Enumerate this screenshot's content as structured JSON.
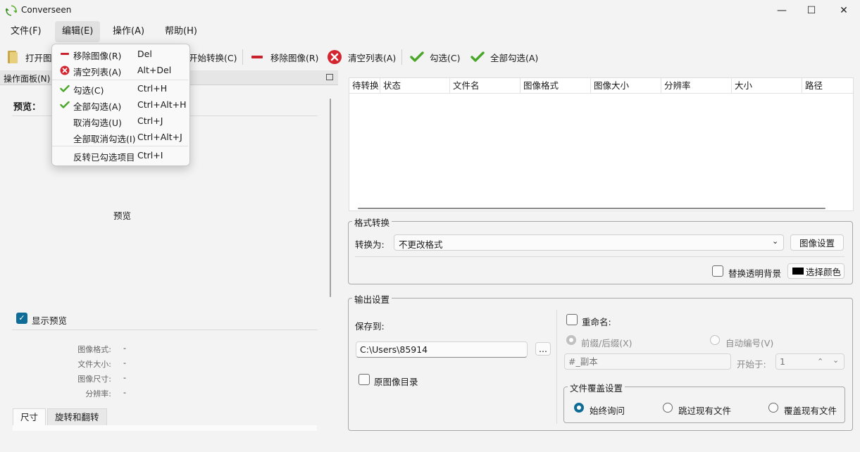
{
  "window": {
    "title": "Converseen",
    "minimize": "—",
    "maximize": "☐",
    "close": "✕"
  },
  "menubar": [
    "文件(F)",
    "编辑(E)",
    "操作(A)",
    "帮助(H)"
  ],
  "toolbar": {
    "open": "打开图",
    "convert": "开始转换(C)",
    "remove": "移除图像(R)",
    "clear": "清空列表(A)",
    "check": "勾选(C)",
    "check_all": "全部勾选(A)"
  },
  "edit_menu": [
    {
      "label": "移除图像(R)",
      "shortcut": "Del",
      "icon": "minus-red-icon"
    },
    {
      "label": "清空列表(A)",
      "shortcut": "Alt+Del",
      "icon": "clear-red-icon"
    },
    {
      "label": "勾选(C)",
      "shortcut": "Ctrl+H",
      "icon": "check-green-icon"
    },
    {
      "label": "全部勾选(A)",
      "shortcut": "Ctrl+Alt+H",
      "icon": "check-green-icon"
    },
    {
      "label": "取消勾选(U)",
      "shortcut": "Ctrl+J",
      "icon": ""
    },
    {
      "label": "全部取消勾选(I)",
      "shortcut": "Ctrl+Alt+J",
      "icon": ""
    },
    {
      "label": "反转已勾选项目",
      "shortcut": "Ctrl+I",
      "icon": ""
    }
  ],
  "left_panel": {
    "title": "操作面板(N)",
    "preview_label": "预览：",
    "preview_placeholder": "预览",
    "show_preview": "显示预览",
    "show_preview_checked": true,
    "info": [
      {
        "key": "图像格式:",
        "value": "-"
      },
      {
        "key": "文件大小:",
        "value": "-"
      },
      {
        "key": "图像尺寸:",
        "value": "-"
      },
      {
        "key": "分辨率:",
        "value": "-"
      }
    ],
    "tabs": [
      "尺寸",
      "旋转和翻转"
    ]
  },
  "table": {
    "columns": [
      "待转换",
      "状态",
      "文件名",
      "图像格式",
      "图像大小",
      "分辨率",
      "大小",
      "路径"
    ]
  },
  "format_group": {
    "title": "格式转换",
    "convert_to_label": "转换为:",
    "convert_to_value": "不更改格式",
    "image_settings": "图像设置",
    "replace_bg": "替换透明背景",
    "choose_color": "选择颜色",
    "color": "#000000"
  },
  "output_group": {
    "title": "输出设置",
    "save_to_label": "保存到:",
    "save_path": "C:\\Users\\85914",
    "browse": "...",
    "original_dir": "原图像目录",
    "rename": "重命名:",
    "prefix_suffix": "前缀/后缀(X)",
    "auto_number": "自动编号(V)",
    "suffix_value": "#_副本",
    "start_at_label": "开始于:",
    "start_at_value": "1",
    "overwrite_title": "文件覆盖设置",
    "overwrite_options": [
      "始终询问",
      "跳过现有文件",
      "覆盖现有文件"
    ]
  }
}
